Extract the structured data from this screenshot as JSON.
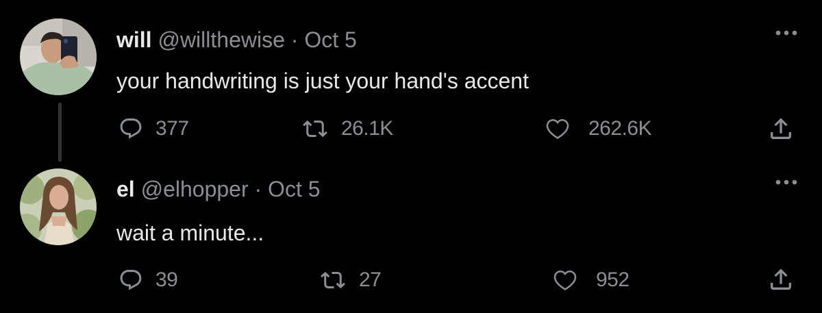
{
  "colors": {
    "background": "#000000",
    "text_primary": "#e7e9ea",
    "text_secondary": "#8b8f93",
    "thread_line": "#2f3336"
  },
  "icons": {
    "reply": "speech-bubble-icon",
    "retweet": "retweet-icon",
    "like": "heart-icon",
    "share": "share-upload-icon",
    "more": "ellipsis-icon"
  },
  "tweets": [
    {
      "display_name": "will",
      "handle": "@willthewise",
      "separator": "·",
      "date": "Oct 5",
      "text": "your handwriting is just your hand's accent",
      "replies": "377",
      "retweets": "26.1K",
      "likes": "262.6K"
    },
    {
      "display_name": "el",
      "handle": "@elhopper",
      "separator": "·",
      "date": "Oct 5",
      "text": "wait a minute...",
      "replies": "39",
      "retweets": "27",
      "likes": "952"
    }
  ]
}
